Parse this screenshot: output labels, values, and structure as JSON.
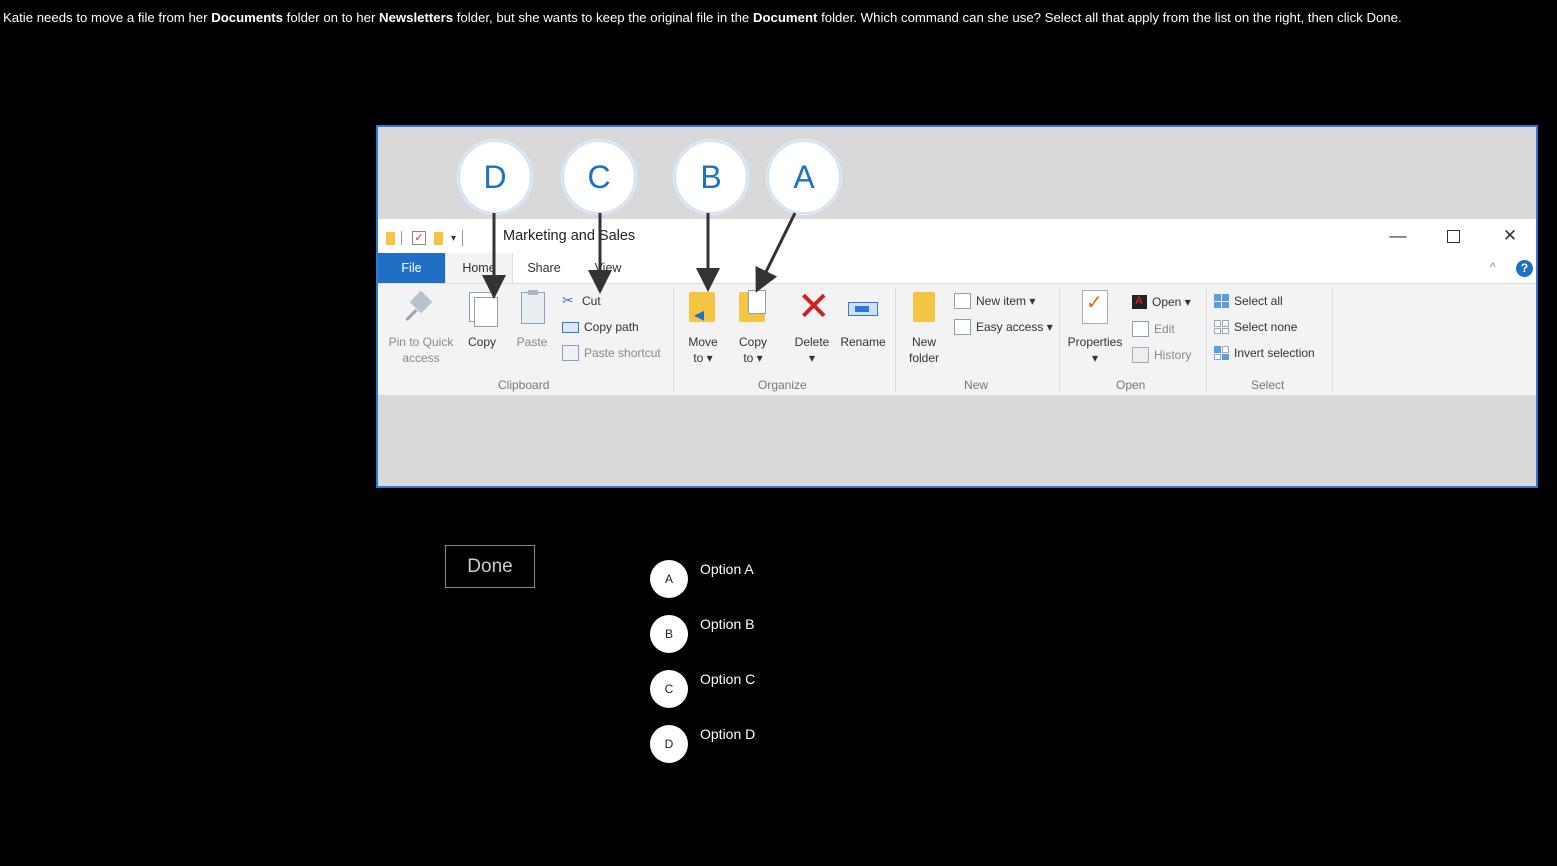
{
  "question": {
    "p1": "Katie needs to move a file from her ",
    "b1": "Documents",
    "p2": " folder on to her ",
    "b2": "Newsletters",
    "p3": " folder, but she wants to keep the original file in the ",
    "b3": "Document",
    "p4": " folder. Which command can she use? Select all that apply from the list on the right, then click Done."
  },
  "explorer": {
    "title": "Marketing and Sales",
    "tabs": [
      "File",
      "Home",
      "Share",
      "View"
    ],
    "groups": {
      "clipboard": "Clipboard",
      "organize": "Organize",
      "new": "New",
      "open": "Open",
      "select": "Select"
    },
    "buttons": {
      "pin_l1": "Pin to Quick",
      "pin_l2": "access",
      "copy": "Copy",
      "paste": "Paste",
      "cut": "Cut",
      "copy_path": "Copy path",
      "paste_shortcut": "Paste shortcut",
      "move_l1": "Move",
      "move_l2": "to ▾",
      "copyto_l1": "Copy",
      "copyto_l2": "to ▾",
      "delete": "Delete",
      "delete_caret": "▾",
      "rename": "Rename",
      "newfolder_l1": "New",
      "newfolder_l2": "folder",
      "new_item": "New item ▾",
      "easy_access": "Easy access ▾",
      "properties": "Properties",
      "properties_caret": "▾",
      "open": "Open ▾",
      "edit": "Edit",
      "history": "History",
      "select_all": "Select all",
      "select_none": "Select none",
      "invert_selection": "Invert selection"
    },
    "window_controls": {
      "minimize": "—",
      "close": "✕"
    },
    "help": "?",
    "ribbon_collapse": "^"
  },
  "callouts": [
    "D",
    "C",
    "B",
    "A"
  ],
  "done_label": "Done",
  "options": [
    {
      "letter": "A",
      "label": "Option A"
    },
    {
      "letter": "B",
      "label": "Option B"
    },
    {
      "letter": "C",
      "label": "Option C"
    },
    {
      "letter": "D",
      "label": "Option D"
    }
  ],
  "colors": {
    "accent": "#1e6fc5",
    "frame_border": "#2d7ad6",
    "background": "#000000"
  }
}
